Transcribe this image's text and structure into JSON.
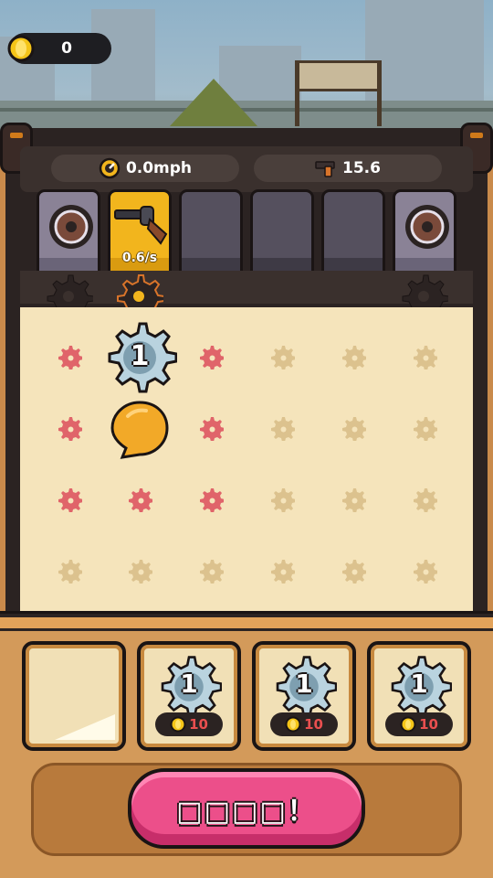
{
  "hud": {
    "coins": "0",
    "coin_icon": "coin-icon"
  },
  "stats": {
    "speed": "0.0mph",
    "speed_icon": "speedometer-icon",
    "damage": "15.6",
    "damage_icon": "pistol-icon"
  },
  "weapon_slots": [
    {
      "kind": "wheel",
      "icon": "wheel-icon"
    },
    {
      "kind": "revolver",
      "icon": "revolver-icon",
      "rate": "0.6/s",
      "active": true
    },
    {
      "kind": "empty"
    },
    {
      "kind": "empty"
    },
    {
      "kind": "empty"
    },
    {
      "kind": "wheel",
      "icon": "wheel-icon"
    }
  ],
  "board": {
    "gear_level": "1",
    "red_cells": [
      "0,0",
      "2,0",
      "0,1",
      "2,1",
      "0,2",
      "1,2",
      "2,2"
    ],
    "placed_gear_cell": "1,0",
    "bubble_cell": "1,1"
  },
  "shop": [
    {
      "empty": true
    },
    {
      "level": "1",
      "price": "10"
    },
    {
      "level": "1",
      "price": "10"
    },
    {
      "level": "1",
      "price": "10"
    }
  ],
  "buy_button": {
    "label": "□□□□！"
  },
  "colors": {
    "accent": "#ec4f8a",
    "gold": "#f2b51d",
    "board": "#f5e4bb",
    "frame": "#2b2322"
  }
}
